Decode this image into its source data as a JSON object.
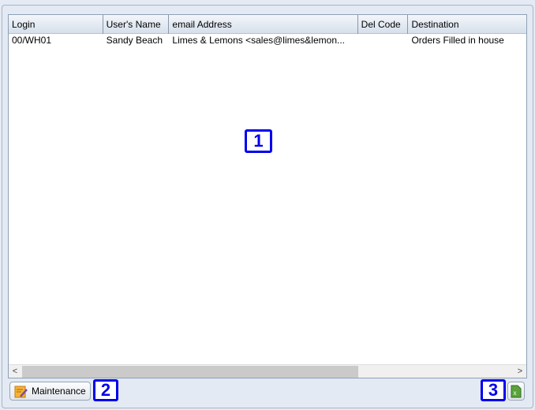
{
  "table": {
    "columns": [
      "Login",
      "User's Name",
      "email Address",
      "Del Code",
      "Destination"
    ],
    "rows": [
      [
        "00/WH01",
        "Sandy Beach",
        "Limes & Lemons <sales@limes&lemon...",
        "",
        "Orders Filled in house"
      ]
    ]
  },
  "callouts": [
    "1",
    "2",
    "3"
  ],
  "footer": {
    "maintenance_label": "Maintenance",
    "maintenance_icon": "notepad-pencil-icon",
    "export_icon": "excel-icon"
  },
  "scrollbar": {
    "left": "<",
    "right": ">"
  }
}
